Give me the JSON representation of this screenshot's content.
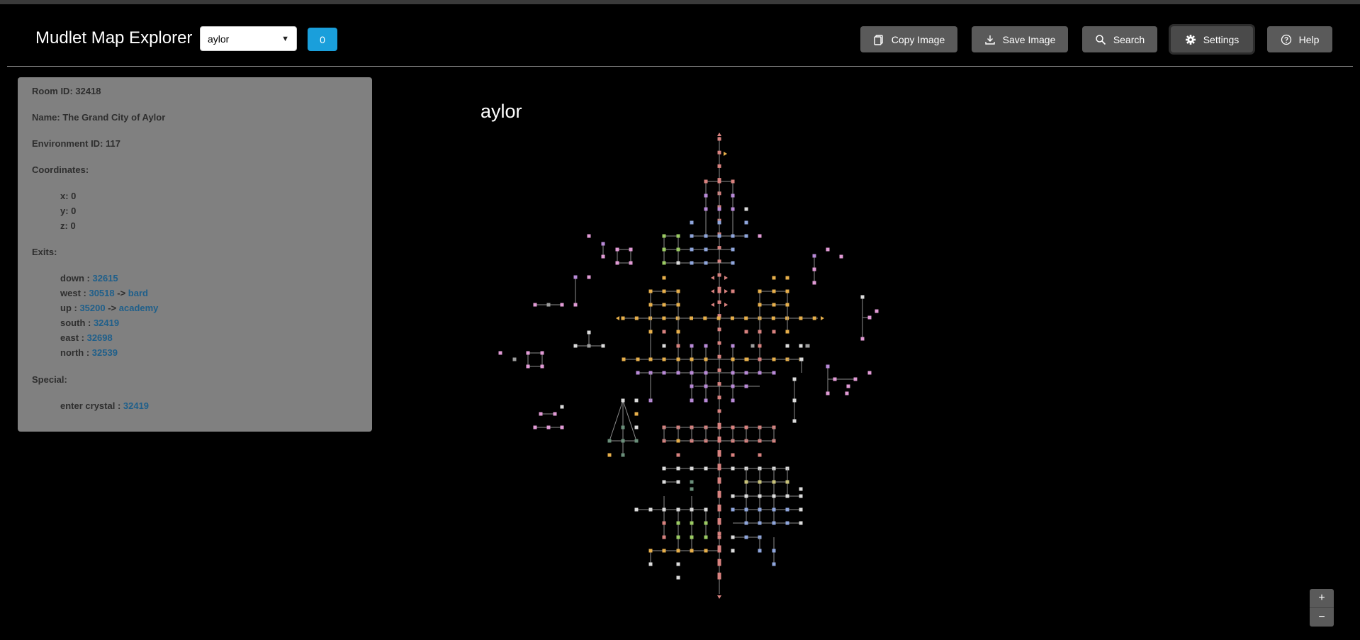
{
  "header": {
    "title": "Mudlet Map Explorer",
    "area_select": "aylor",
    "count": "0",
    "copy_image": "Copy Image",
    "save_image": "Save Image",
    "search": "Search",
    "settings": "Settings",
    "help": "Help"
  },
  "room": {
    "room_id": "Room ID: 32418",
    "name": "Name: The Grand City of Aylor",
    "environment": "Environment ID: 117",
    "coordinates_label": "Coordinates:",
    "x": "x: 0",
    "y": "y: 0",
    "z": "z: 0",
    "exits_label": "Exits:",
    "exits": [
      {
        "dir": "down",
        "id": "32615",
        "target": ""
      },
      {
        "dir": "west",
        "id": "30518",
        "target": "bard"
      },
      {
        "dir": "up",
        "id": "35200",
        "target": "academy"
      },
      {
        "dir": "south",
        "id": "32419",
        "target": ""
      },
      {
        "dir": "east",
        "id": "32698",
        "target": ""
      },
      {
        "dir": "north",
        "id": "32539",
        "target": ""
      }
    ],
    "special_label": "Special:",
    "special": [
      {
        "cmd": "enter crystal",
        "id": "32419"
      }
    ]
  },
  "map": {
    "area_name": "aylor",
    "colors": {
      "red": "#d9827f",
      "purple": "#b98ad8",
      "blue": "#8fa6dd",
      "yellow": "#e8b04b",
      "green": "#9ccc63",
      "white": "#dcdcdc",
      "pink": "#e29bd6",
      "gray": "#9e9e9e",
      "khaki": "#c9c37a",
      "teal": "#6a8f7a"
    }
  },
  "zoom": {
    "in": "+",
    "out": "−"
  }
}
